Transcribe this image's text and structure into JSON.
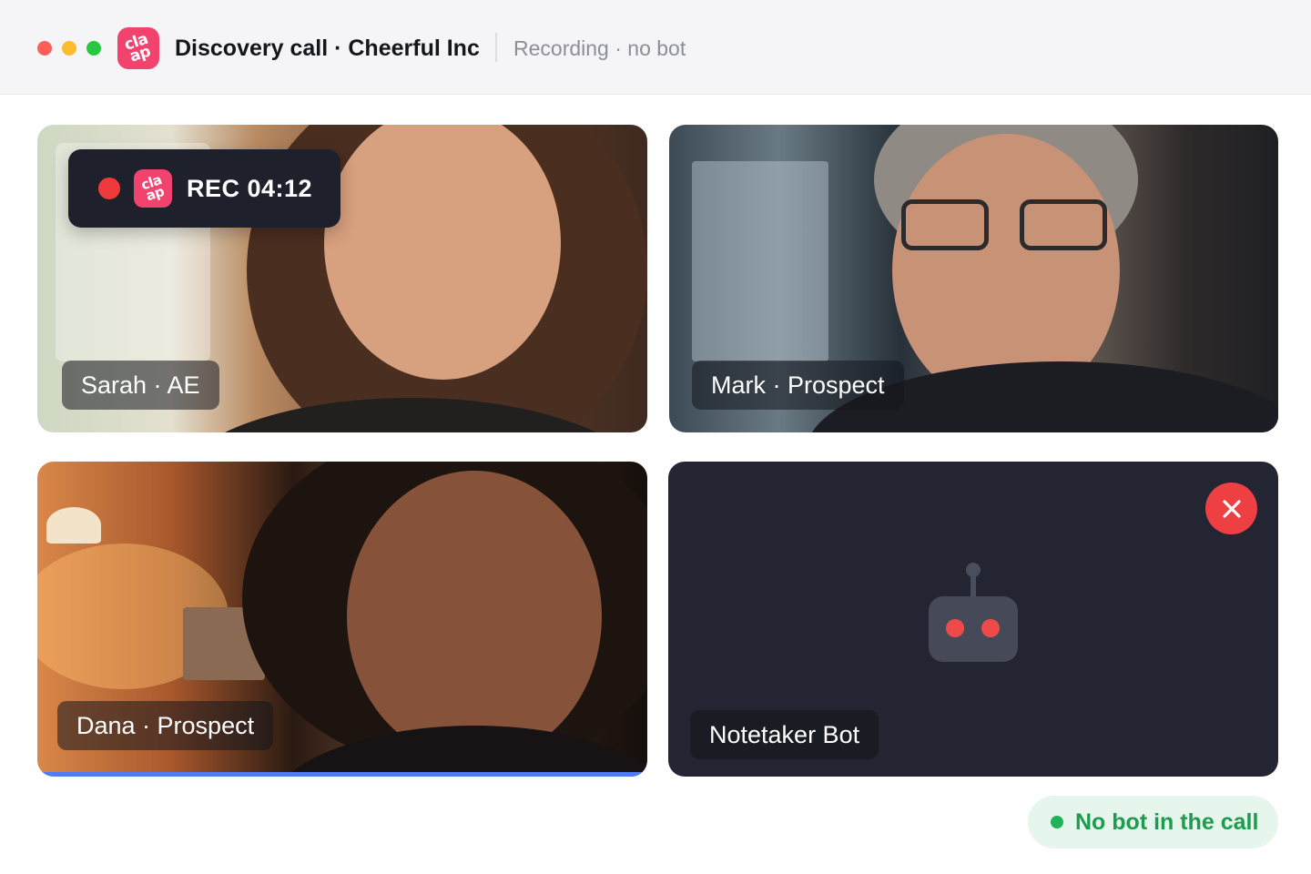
{
  "window": {
    "controls": [
      "close",
      "minimize",
      "maximize"
    ],
    "app_logo_text": "cla ap",
    "call_title": "Discovery call · Cheerful Inc",
    "call_status": "Recording · no bot"
  },
  "recording": {
    "label": "REC 04:12",
    "logo_text": "cla ap",
    "color": "#f0393a"
  },
  "participants": [
    {
      "name": "Sarah · AE",
      "speaking": false
    },
    {
      "name": "Mark · Prospect",
      "speaking": false
    },
    {
      "name": "Dana · Prospect",
      "speaking": true
    },
    {
      "name": "Notetaker Bot",
      "removed": true
    }
  ],
  "bot_tile": {
    "icon": "robot-icon",
    "remove_icon": "close-icon",
    "remove_color": "#ee3f43"
  },
  "status_chip": {
    "text": "No bot in the call",
    "color": "#22b35a"
  },
  "colors": {
    "brand": "#f2436e",
    "speaking_outline": "#4f7bf5",
    "tile_dark": "#232632"
  }
}
